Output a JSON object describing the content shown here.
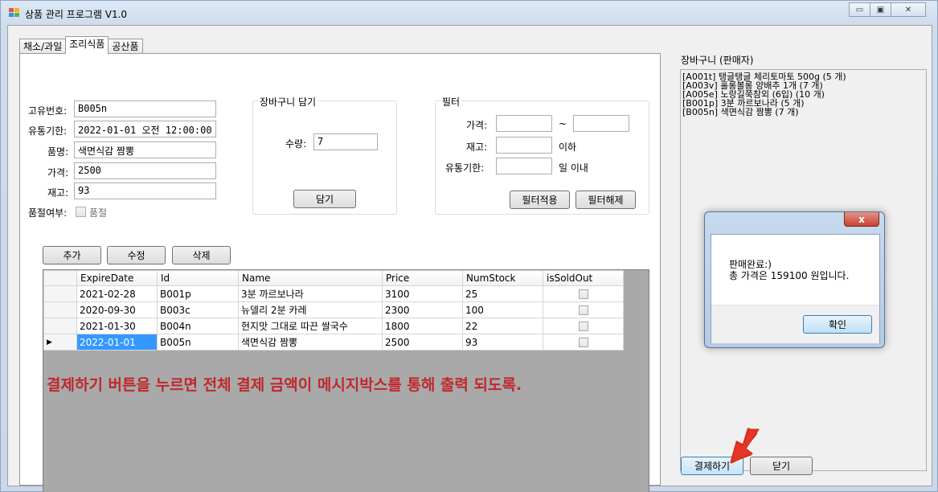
{
  "window": {
    "title": "상품 관리 프로그램 V1.0",
    "controls": {
      "minimize": "▭",
      "maximize": "▣",
      "close": "✕"
    }
  },
  "tabs": [
    {
      "label": "채소/과일"
    },
    {
      "label": "조리식품"
    },
    {
      "label": "공산품"
    }
  ],
  "form": {
    "id_label": "고유번호:",
    "id_value": "B005n",
    "expire_label": "유통기한:",
    "expire_value": "2022-01-01 오전 12:00:00",
    "name_label": "품명:",
    "name_value": "색면식감 짬뽕",
    "price_label": "가격:",
    "price_value": "2500",
    "stock_label": "재고:",
    "stock_value": "93",
    "soldout_label": "품절여부:",
    "soldout_check_label": "품절"
  },
  "cart_add": {
    "group_title": "장바구니 담기",
    "qty_label": "수량:",
    "qty_value": "7",
    "add_button": "담기"
  },
  "filter": {
    "group_title": "필터",
    "price_label": "가격:",
    "tilde": "~",
    "stock_label": "재고:",
    "stock_suffix": "이하",
    "expire_label": "유통기한:",
    "expire_suffix": "일 이내",
    "apply_button": "필터적용",
    "clear_button": "필터해제"
  },
  "actions": {
    "add": "추가",
    "edit": "수정",
    "delete": "삭제"
  },
  "grid": {
    "columns": [
      "ExpireDate",
      "Id",
      "Name",
      "Price",
      "NumStock",
      "isSoldOut"
    ],
    "rows": [
      {
        "indicator": "",
        "ExpireDate": "2021-02-28",
        "Id": "B001p",
        "Name": "3분 까르보나라",
        "Price": "3100",
        "NumStock": "25"
      },
      {
        "indicator": "",
        "ExpireDate": "2020-09-30",
        "Id": "B003c",
        "Name": "뉴델리 2분 카레",
        "Price": "2300",
        "NumStock": "100"
      },
      {
        "indicator": "",
        "ExpireDate": "2021-01-30",
        "Id": "B004n",
        "Name": "현지맛 그대로 따끈 쌀국수",
        "Price": "1800",
        "NumStock": "22"
      },
      {
        "indicator": "▶",
        "ExpireDate": "2022-01-01",
        "Id": "B005n",
        "Name": "색면식감 짬뽕",
        "Price": "2500",
        "NumStock": "93"
      }
    ]
  },
  "annotation": "결제하기 버튼을 누르면 전체 결제 금액이 메시지박스를 통해 출력 되도록.",
  "cart": {
    "title": "장바구니 (판매자)",
    "items": [
      "[A001t] 탱글탱글 체리토마토 500g (5 개)",
      "[A003v] 홀롱볼롱 양배추 1개 (7 개)",
      "[A005e] 노랑길쭉참외 (6입) (10 개)",
      "[B001p] 3분 까르보나라 (5 개)",
      "[B005n] 색면식감 짬뽕 (7 개)"
    ],
    "pay_button": "결제하기",
    "close_button": "닫기"
  },
  "message_box": {
    "close": "x",
    "line1": "판매완료:)",
    "line2": "총 가격은 159100 원입니다.",
    "ok_button": "확인"
  },
  "colors": {
    "annotation": "#c0282d",
    "arrow": "#e53626",
    "selection": "#3399ff"
  }
}
